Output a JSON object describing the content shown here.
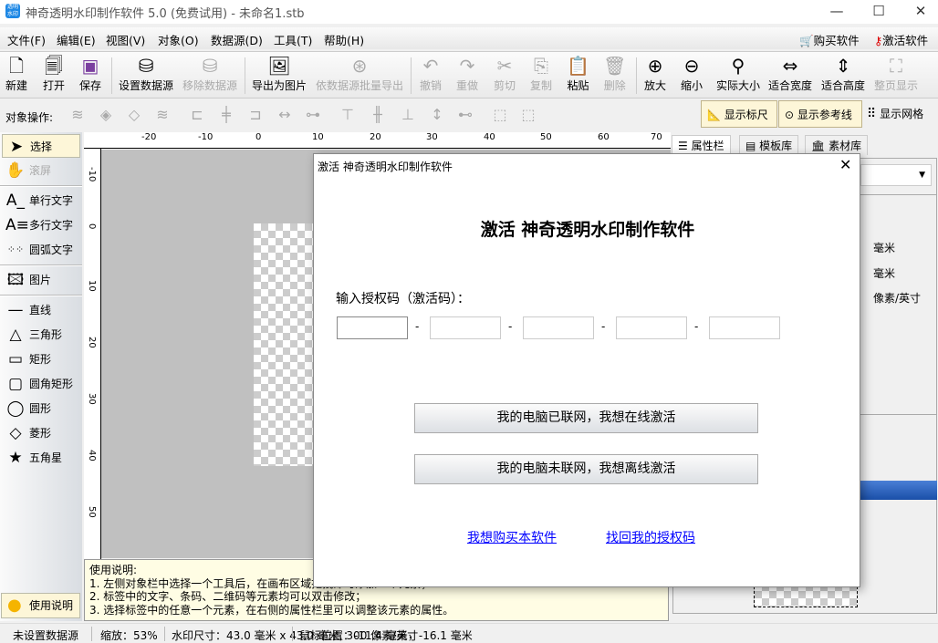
{
  "window": {
    "title": "神奇透明水印制作软件 5.0 (免费试用) - 未命名1.stb",
    "icon_text": "透明水印",
    "minimize": "—",
    "maximize": "☐",
    "close": "✕"
  },
  "menu": [
    "文件(F)",
    "编辑(E)",
    "视图(V)",
    "对象(O)",
    "数据源(D)",
    "工具(T)",
    "帮助(H)"
  ],
  "menu_right": {
    "buy": "购买软件",
    "activate": "激活软件"
  },
  "toolbar": [
    "新建",
    "打开",
    "保存",
    "设置数据源",
    "移除数据源",
    "导出为图片",
    "依数据源批量导出",
    "撤销",
    "重做",
    "剪切",
    "复制",
    "粘贴",
    "删除",
    "放大",
    "缩小",
    "实际大小",
    "适合宽度",
    "适合高度",
    "整页显示"
  ],
  "objbar": {
    "label": "对象操作:",
    "show_ruler": "显示标尺",
    "show_guides": "显示参考线",
    "show_grid": "显示网格"
  },
  "tools": [
    "选择",
    "滚屏",
    "单行文字",
    "多行文字",
    "圆弧文字",
    "图片",
    "直线",
    "三角形",
    "矩形",
    "圆角矩形",
    "圆形",
    "菱形",
    "五角星"
  ],
  "ruler": {
    "top": [
      "-20",
      "-10",
      "0",
      "10",
      "20",
      "30",
      "40",
      "50",
      "60",
      "70"
    ],
    "left": [
      "-10",
      "0",
      "10",
      "20",
      "30",
      "40",
      "50"
    ]
  },
  "right_tabs": [
    "属性栏",
    "模板库",
    "素材库"
  ],
  "props": {
    "unit1": "毫米",
    "unit2": "毫米",
    "unit3": "像素/英寸"
  },
  "info": {
    "title": "使用说明:",
    "lines": [
      "1. 左侧对象栏中选择一个工具后，在画布区域拖拽即可添加一个元素；",
      "2. 标签中的文字、条码、二维码等元素均可以双击修改；",
      "3. 选择标签中的任意一个元素，在右侧的属性栏里可以调整该元素的属性。"
    ]
  },
  "guide_button": "使用说明",
  "status": {
    "datasource": "未设置数据源",
    "zoom": "缩放：53%",
    "size": "水印尺寸：43.0 毫米 x 43.0 毫米, 300 像素/英寸",
    "mouse": "鼠标位置：-11.4 毫米，-16.1 毫米"
  },
  "dialog": {
    "title": "激活 神奇透明水印制作软件",
    "heading": "激活 神奇透明水印制作软件",
    "label": "输入授权码（激活码）：",
    "codes": [
      "",
      "",
      "",
      "",
      ""
    ],
    "dash": "-",
    "online": "我的电脑已联网，我想在线激活",
    "offline": "我的电脑未联网，我想离线激活",
    "buy_link": "我想购买本软件",
    "recover_link": "找回我的授权码",
    "close": "✕"
  }
}
